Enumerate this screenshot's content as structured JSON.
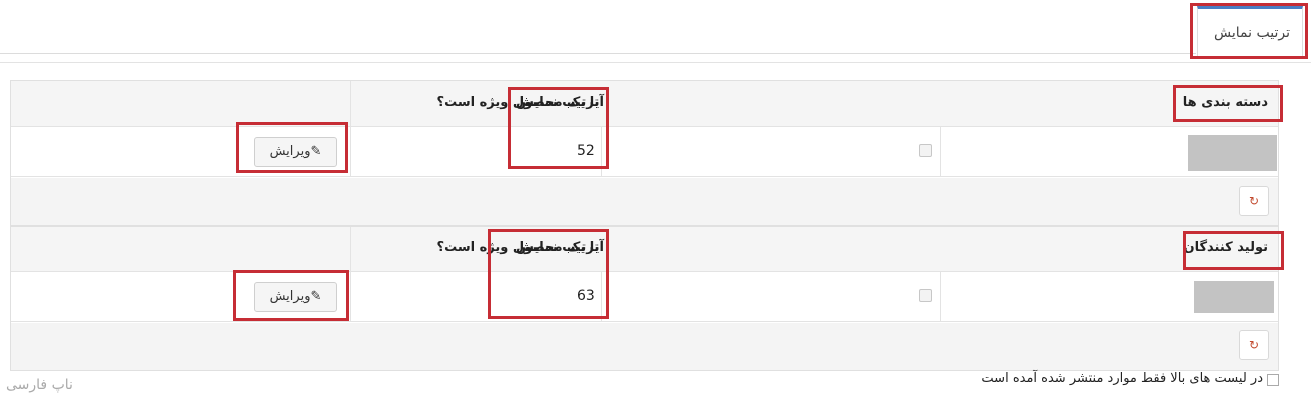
{
  "tab": {
    "label": "ترتیب نمایش"
  },
  "section_categories": {
    "col_title": "دسته بندی ها",
    "col_featured": "آیا یک محصول ویژه است؟",
    "col_order": "ترتیب نمایش",
    "order_value": "52",
    "edit_label": "ویرایش"
  },
  "section_manufacturers": {
    "col_title": "تولید کنندگان",
    "col_featured": "آیا یک محصول ویژه است؟",
    "col_order": "ترتیب نمایش",
    "order_value": "63",
    "edit_label": "ویرایش"
  },
  "note": "در لیست های بالا فقط موارد منتشر شده آمده است",
  "brand": "ناپ فارسی",
  "icons": {
    "edit": "pencil-icon",
    "refresh": "refresh-icon"
  },
  "colors": {
    "highlight": "#c62d35",
    "tab_accent": "#4a7ec4"
  }
}
